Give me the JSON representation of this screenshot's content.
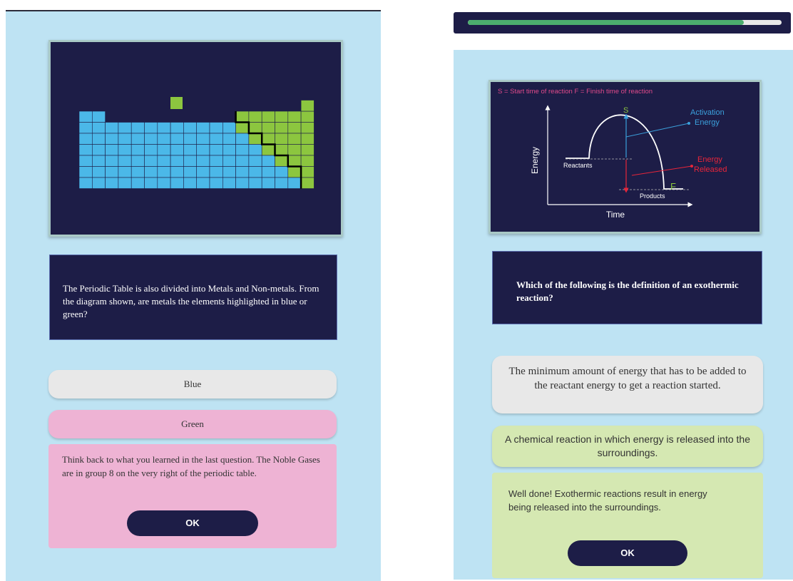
{
  "left": {
    "question": "The Periodic Table is also divided into Metals and Non-metals. From the diagram shown, are metals the elements highlighted in blue or green?",
    "options": [
      "Blue",
      "Green"
    ],
    "feedback": "Think back to what you learned in the last question. The Noble Gases are in group 8 on the very right of the periodic table.",
    "ok_label": "OK",
    "colors": {
      "metal": "#4bb8e8",
      "nonmetal": "#8cc63f",
      "selected": "#eeb3d4"
    }
  },
  "right": {
    "progress_fraction": 0.88,
    "diagram": {
      "legend": "S = Start time of reaction    F = Finish time of reaction",
      "y_axis": "Energy",
      "x_axis": "Time",
      "start_marker": "S",
      "finish_marker": "F",
      "reactants": "Reactants",
      "products": "Products",
      "activation_label_1": "Activation",
      "activation_label_2": "Energy",
      "released_label_1": "Energy",
      "released_label_2": "Released"
    },
    "question": "Which of the following is the definition of an exothermic reaction?",
    "options": [
      "The minimum amount of energy that has to be added to the reactant energy to get a reaction started.",
      "A chemical reaction in which energy is released into the surroundings."
    ],
    "feedback": "Well done! Exothermic reactions result in energy being released into the surroundings.",
    "ok_label": "OK",
    "colors": {
      "correct": "#d5e8b2"
    }
  }
}
